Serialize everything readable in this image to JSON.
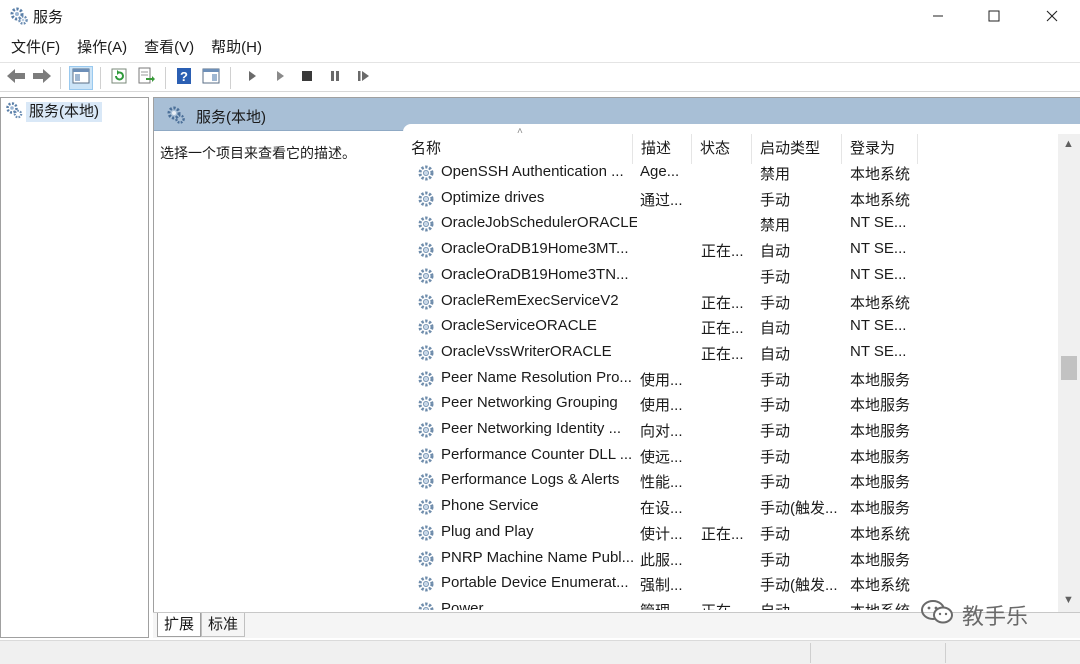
{
  "window": {
    "title": "服务"
  },
  "menu": [
    "文件(F)",
    "操作(A)",
    "查看(V)",
    "帮助(H)"
  ],
  "tree": {
    "node_label": "服务(本地)"
  },
  "pane": {
    "header_title": "服务(本地)",
    "description_hint": "选择一个项目来查看它的描述。"
  },
  "columns": {
    "name": "名称",
    "description": "描述",
    "status": "状态",
    "startup": "启动类型",
    "logon": "登录为"
  },
  "rows": [
    {
      "name": "OpenSSH Authentication ...",
      "desc": "Age...",
      "status": "",
      "start": "禁用",
      "logon": "本地系统"
    },
    {
      "name": "Optimize drives",
      "desc": "通过...",
      "status": "",
      "start": "手动",
      "logon": "本地系统"
    },
    {
      "name": "OracleJobSchedulerORACLE",
      "desc": "",
      "status": "",
      "start": "禁用",
      "logon": "NT SE..."
    },
    {
      "name": "OracleOraDB19Home3MT...",
      "desc": "",
      "status": "正在...",
      "start": "自动",
      "logon": "NT SE..."
    },
    {
      "name": "OracleOraDB19Home3TN...",
      "desc": "",
      "status": "",
      "start": "手动",
      "logon": "NT SE..."
    },
    {
      "name": "OracleRemExecServiceV2",
      "desc": "",
      "status": "正在...",
      "start": "手动",
      "logon": "本地系统"
    },
    {
      "name": "OracleServiceORACLE",
      "desc": "",
      "status": "正在...",
      "start": "自动",
      "logon": "NT SE..."
    },
    {
      "name": "OracleVssWriterORACLE",
      "desc": "",
      "status": "正在...",
      "start": "自动",
      "logon": "NT SE..."
    },
    {
      "name": "Peer Name Resolution Pro...",
      "desc": "使用...",
      "status": "",
      "start": "手动",
      "logon": "本地服务"
    },
    {
      "name": "Peer Networking Grouping",
      "desc": "使用...",
      "status": "",
      "start": "手动",
      "logon": "本地服务"
    },
    {
      "name": "Peer Networking Identity ...",
      "desc": "向对...",
      "status": "",
      "start": "手动",
      "logon": "本地服务"
    },
    {
      "name": "Performance Counter DLL ...",
      "desc": "使远...",
      "status": "",
      "start": "手动",
      "logon": "本地服务"
    },
    {
      "name": "Performance Logs & Alerts",
      "desc": "性能...",
      "status": "",
      "start": "手动",
      "logon": "本地服务"
    },
    {
      "name": "Phone Service",
      "desc": "在设...",
      "status": "",
      "start": "手动(触发...",
      "logon": "本地服务"
    },
    {
      "name": "Plug and Play",
      "desc": "使计...",
      "status": "正在...",
      "start": "手动",
      "logon": "本地系统"
    },
    {
      "name": "PNRP Machine Name Publ...",
      "desc": "此服...",
      "status": "",
      "start": "手动",
      "logon": "本地服务"
    },
    {
      "name": "Portable Device Enumerat...",
      "desc": "强制...",
      "status": "",
      "start": "手动(触发...",
      "logon": "本地系统"
    },
    {
      "name": "Power",
      "desc": "管理...",
      "status": "正在...",
      "start": "自动",
      "logon": "本地系统"
    }
  ],
  "tabs": [
    "扩展",
    "标准"
  ],
  "watermark": "教手乐"
}
